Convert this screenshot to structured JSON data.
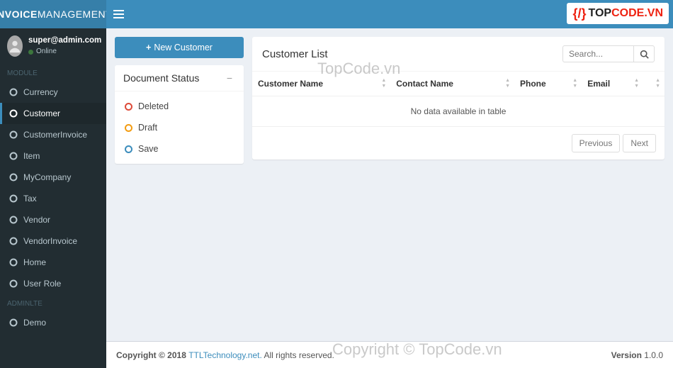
{
  "brand": {
    "bold": "INVOICE",
    "light": "MANAGEMENT"
  },
  "topLogo": {
    "p1": "TOP",
    "p2": "CODE",
    "suffix": ".VN"
  },
  "user": {
    "name": "super@admin.com",
    "status": "Online"
  },
  "navHeaders": {
    "module": "MODULE",
    "adminlte": "ADMINLTE"
  },
  "nav": [
    {
      "label": "Currency",
      "active": false
    },
    {
      "label": "Customer",
      "active": true
    },
    {
      "label": "CustomerInvoice",
      "active": false
    },
    {
      "label": "Item",
      "active": false
    },
    {
      "label": "MyCompany",
      "active": false
    },
    {
      "label": "Tax",
      "active": false
    },
    {
      "label": "Vendor",
      "active": false
    },
    {
      "label": "VendorInvoice",
      "active": false
    },
    {
      "label": "Home",
      "active": false
    },
    {
      "label": "User Role",
      "active": false
    }
  ],
  "navDemo": {
    "label": "Demo"
  },
  "newButton": "New Customer",
  "docStatus": {
    "title": "Document Status",
    "items": [
      {
        "label": "Deleted",
        "color": "#dd4b39"
      },
      {
        "label": "Draft",
        "color": "#f39c12"
      },
      {
        "label": "Save",
        "color": "#3c8dbc"
      }
    ]
  },
  "panel": {
    "title": "Customer List",
    "searchPlaceholder": "Search...",
    "columns": [
      "Customer Name",
      "Contact Name",
      "Phone",
      "Email",
      ""
    ],
    "emptyText": "No data available in table",
    "prev": "Previous",
    "next": "Next"
  },
  "footer": {
    "copyPrefix": "Copyright © 2018 ",
    "company": "TTLTechnology.net.",
    "rights": " All rights reserved.",
    "versionLabel": "Version",
    "version": " 1.0.0"
  },
  "watermark": {
    "w1": "TopCode.vn",
    "w2": "Copyright © TopCode.vn"
  }
}
